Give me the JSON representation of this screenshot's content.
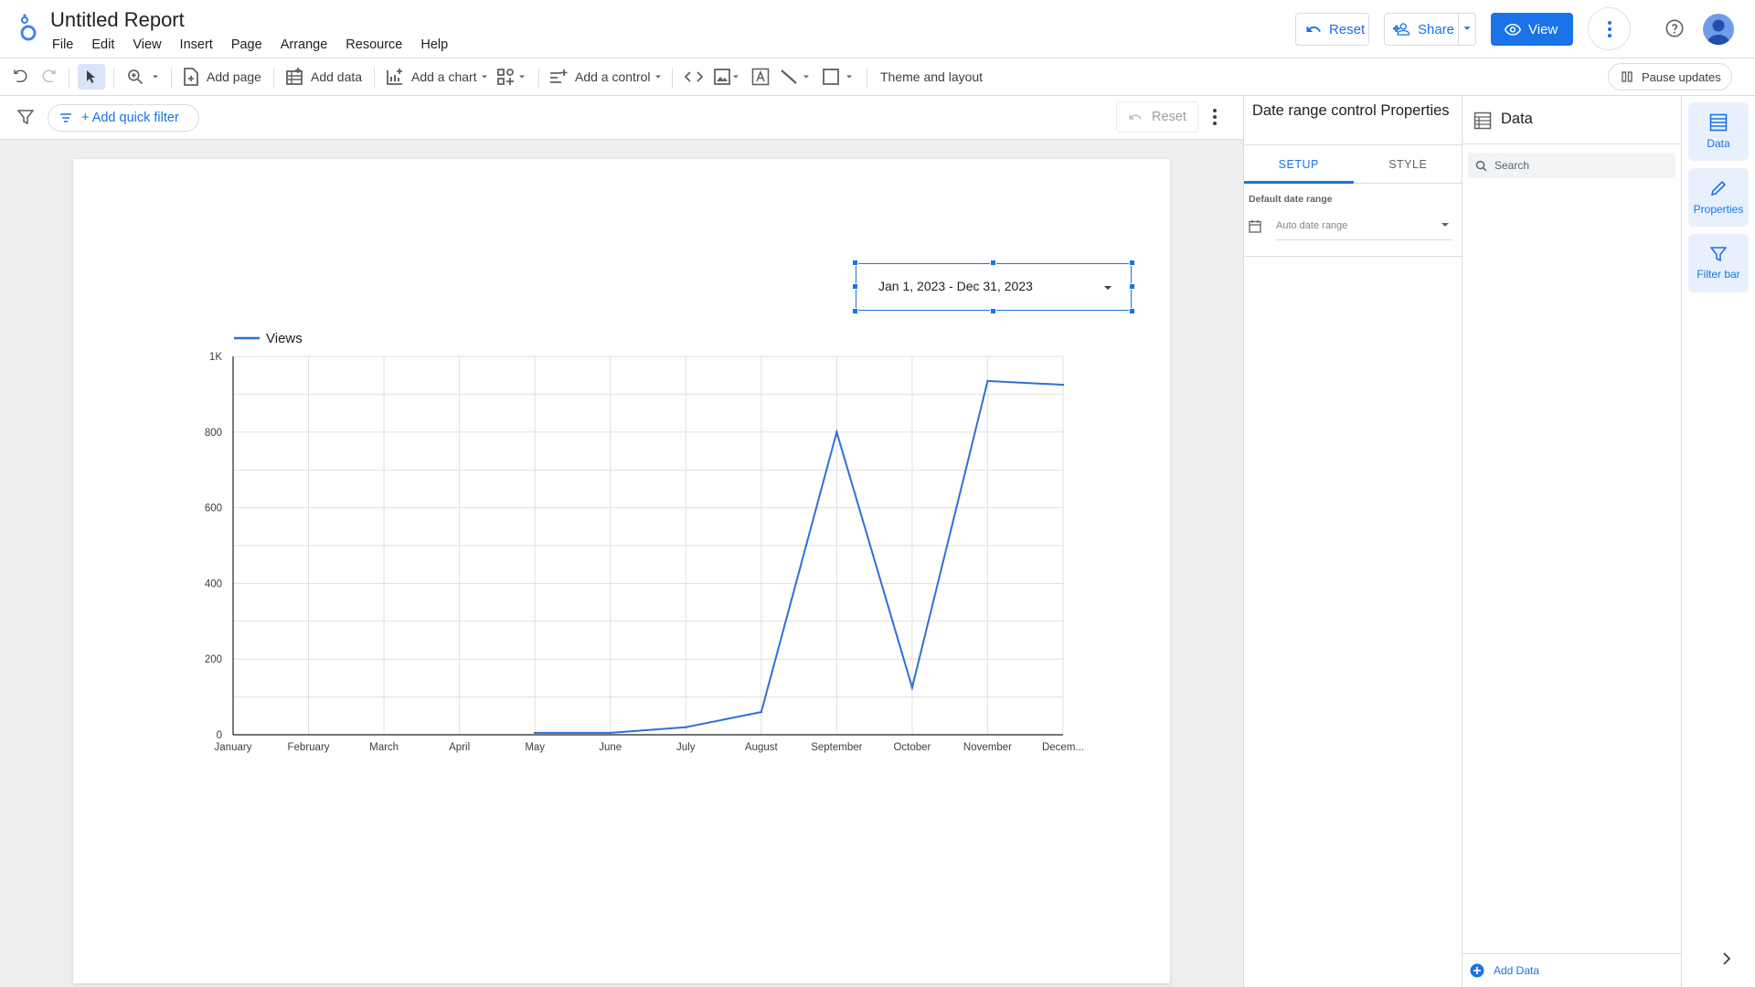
{
  "header": {
    "title": "Untitled Report",
    "menu": [
      "File",
      "Edit",
      "View",
      "Insert",
      "Page",
      "Arrange",
      "Resource",
      "Help"
    ],
    "reset_label": "Reset",
    "share_label": "Share",
    "view_label": "View"
  },
  "toolbar": {
    "add_page": "Add page",
    "add_data": "Add data",
    "add_chart": "Add a chart",
    "add_control": "Add a control",
    "theme_layout": "Theme and layout",
    "pause_updates": "Pause updates"
  },
  "filterbar": {
    "quick_filter": "+ Add quick filter",
    "reset_label": "Reset"
  },
  "date_control": {
    "value": "Jan 1, 2023 - Dec 31, 2023"
  },
  "chart_data": {
    "type": "line",
    "categories": [
      "January",
      "February",
      "March",
      "April",
      "May",
      "June",
      "July",
      "August",
      "September",
      "October",
      "November",
      "Decem..."
    ],
    "series": [
      {
        "name": "Views",
        "color": "#2f6fd8",
        "values": [
          null,
          null,
          null,
          null,
          5,
          5,
          20,
          60,
          800,
          125,
          935,
          925
        ]
      }
    ],
    "yticks": [
      "0",
      "200",
      "400",
      "600",
      "800",
      "1K"
    ],
    "ylim": [
      0,
      1000
    ],
    "grid": true,
    "legend": "top-left"
  },
  "properties": {
    "title": "Date range control Properties",
    "tab_setup": "SETUP",
    "tab_style": "STYLE",
    "default_range_label": "Default date range",
    "default_range_value": "Auto date range"
  },
  "data_panel": {
    "title": "Data",
    "search_placeholder": "Search",
    "add_data": "Add Data"
  },
  "rail": {
    "data": "Data",
    "properties": "Properties",
    "filter_bar": "Filter bar"
  },
  "colors": {
    "accent": "#1a73e8",
    "line": "#2f6fd8",
    "canvas_bg": "#eeeeee"
  }
}
